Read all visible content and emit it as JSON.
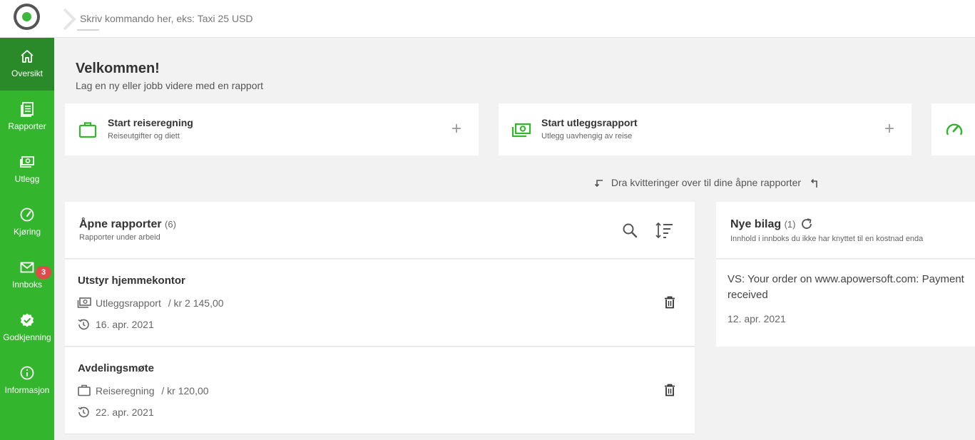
{
  "command": {
    "placeholder": "Skriv kommando her, eks: Taxi 25 USD"
  },
  "sidebar": {
    "items": [
      {
        "label": "Oversikt",
        "icon": "home-icon",
        "active": true
      },
      {
        "label": "Rapporter",
        "icon": "reports-icon"
      },
      {
        "label": "Utlegg",
        "icon": "money-icon"
      },
      {
        "label": "Kjøring",
        "icon": "speedometer-icon"
      },
      {
        "label": "Innboks",
        "icon": "mail-icon"
      },
      {
        "label": "Godkjenning",
        "icon": "approval-badge-icon",
        "badge": "3"
      },
      {
        "label": "Informasjon",
        "icon": "info-icon"
      }
    ]
  },
  "welcome": {
    "title": "Velkommen!",
    "subtitle": "Lag en ny eller jobb videre med en rapport"
  },
  "start_cards": [
    {
      "title": "Start reiseregning",
      "subtitle": "Reiseutgifter og diett",
      "icon": "briefcase-icon",
      "plus": "+"
    },
    {
      "title": "Start utleggsrapport",
      "subtitle": "Utlegg uavhengig av reise",
      "icon": "money-icon",
      "plus": "+"
    },
    {
      "icon": "speedometer-icon"
    }
  ],
  "drag_hint": "Dra kvitteringer over til dine åpne rapporter",
  "open_reports": {
    "title": "Åpne rapporter",
    "count": "(6)",
    "subtitle": "Rapporter under arbeid",
    "items": [
      {
        "name": "Utstyr hjemmekontor",
        "type": "Utleggsrapport",
        "amount": "/ kr 2 145,00",
        "date": "16. apr. 2021",
        "type_icon": "money-icon"
      },
      {
        "name": "Avdelingsmøte",
        "type": "Reiseregning",
        "amount": "/ kr 120,00",
        "date": "22. apr. 2021",
        "type_icon": "briefcase-icon"
      }
    ]
  },
  "new_vouchers": {
    "title": "Nye bilag",
    "count": "(1)",
    "subtitle": "Innhold i innboks du ikke har knyttet til en kostnad enda",
    "items": [
      {
        "subject": "VS: Your order on www.apowersoft.com: Payment received",
        "date": "12. apr. 2021"
      }
    ]
  },
  "colors": {
    "brand_green": "#33b52e",
    "active_green": "#2a8a29",
    "badge_red": "#e04a4a"
  }
}
